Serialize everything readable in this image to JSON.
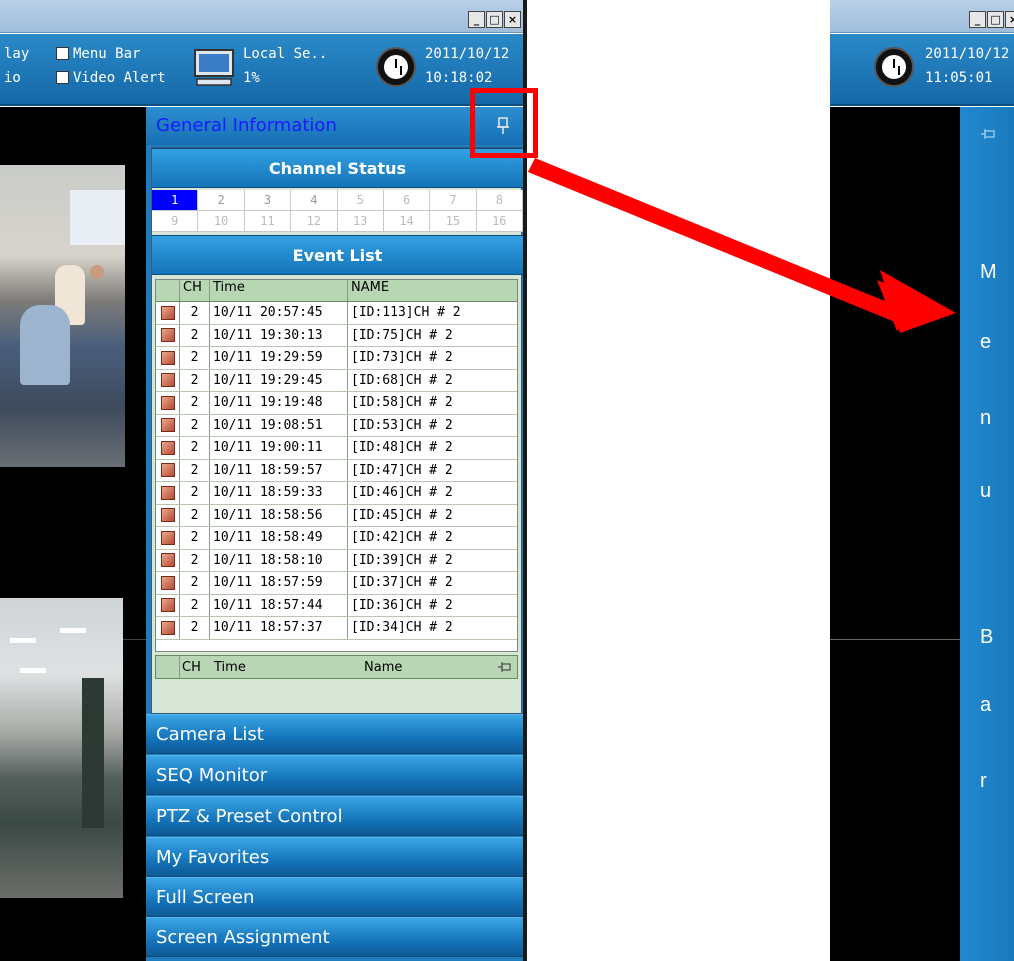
{
  "left_window": {
    "title_buttons": [
      "_",
      "□",
      "×"
    ],
    "toolbar": {
      "display_partial": "lay",
      "audio_partial": "io",
      "menu_bar_label": "Menu Bar",
      "video_alert_label": "Video Alert",
      "local_label": "Local Se..",
      "local_value": "1%",
      "date": "2011/10/12",
      "time": "10:18:02"
    },
    "panel": {
      "title": "General Information",
      "channel_status_title": "Channel Status",
      "channels": [
        "1",
        "2",
        "3",
        "4",
        "5",
        "6",
        "7",
        "8",
        "9",
        "10",
        "11",
        "12",
        "13",
        "14",
        "15",
        "16"
      ],
      "active_channel": "1",
      "event_list_title": "Event List",
      "columns": [
        "CH",
        "Time",
        "NAME"
      ],
      "events": [
        {
          "ch": "2",
          "time": "10/11 20:57:45",
          "name": "[ID:113]CH # 2"
        },
        {
          "ch": "2",
          "time": "10/11 19:30:13",
          "name": "[ID:75]CH # 2"
        },
        {
          "ch": "2",
          "time": "10/11 19:29:59",
          "name": "[ID:73]CH # 2"
        },
        {
          "ch": "2",
          "time": "10/11 19:29:45",
          "name": "[ID:68]CH # 2"
        },
        {
          "ch": "2",
          "time": "10/11 19:19:48",
          "name": "[ID:58]CH # 2"
        },
        {
          "ch": "2",
          "time": "10/11 19:08:51",
          "name": "[ID:53]CH # 2"
        },
        {
          "ch": "2",
          "time": "10/11 19:00:11",
          "name": "[ID:48]CH # 2"
        },
        {
          "ch": "2",
          "time": "10/11 18:59:57",
          "name": "[ID:47]CH # 2"
        },
        {
          "ch": "2",
          "time": "10/11 18:59:33",
          "name": "[ID:46]CH # 2"
        },
        {
          "ch": "2",
          "time": "10/11 18:58:56",
          "name": "[ID:45]CH # 2"
        },
        {
          "ch": "2",
          "time": "10/11 18:58:49",
          "name": "[ID:42]CH # 2"
        },
        {
          "ch": "2",
          "time": "10/11 18:58:10",
          "name": "[ID:39]CH # 2"
        },
        {
          "ch": "2",
          "time": "10/11 18:57:59",
          "name": "[ID:37]CH # 2"
        },
        {
          "ch": "2",
          "time": "10/11 18:57:44",
          "name": "[ID:36]CH # 2"
        },
        {
          "ch": "2",
          "time": "10/11 18:57:37",
          "name": "[ID:34]CH # 2"
        }
      ],
      "footer_columns": [
        "CH",
        "Time",
        "Name"
      ],
      "menu": [
        "Camera List",
        "SEQ Monitor",
        "PTZ & Preset Control",
        "My Favorites",
        "Full Screen",
        "Screen Assignment"
      ]
    }
  },
  "right_window": {
    "title_buttons": [
      "_",
      "□",
      "×"
    ],
    "date": "2011/10/12",
    "time": "11:05:01",
    "menu_bar_letters": [
      "M",
      "e",
      "n",
      "u",
      "B",
      "a",
      "r"
    ]
  },
  "colors": {
    "toolbar_blue": "#1f7cbd",
    "title_link_blue": "#1a1aff",
    "annotation_red": "#ff0000",
    "active_channel_blue": "#0000ff"
  }
}
